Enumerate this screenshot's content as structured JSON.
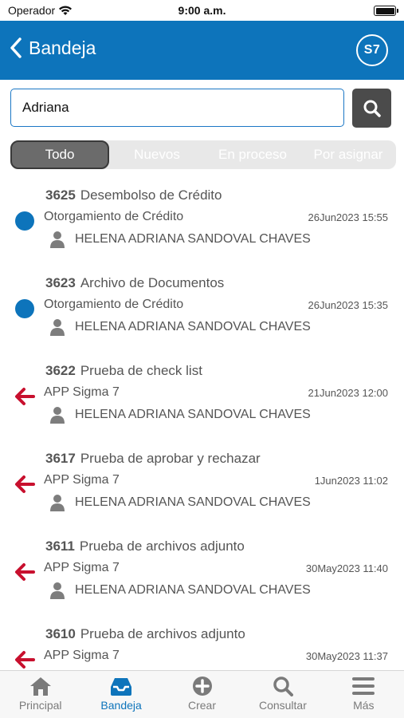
{
  "status_bar": {
    "carrier": "Operador",
    "time": "9:00 a.m."
  },
  "header": {
    "title": "Bandeja",
    "logo_text": "S7"
  },
  "search": {
    "value": "Adriana"
  },
  "filters": [
    "Todo",
    "Nuevos",
    "En proceso",
    "Por asignar"
  ],
  "items": [
    {
      "id": "3625",
      "title": "Desembolso de Crédito",
      "process": "Otorgamiento de Crédito",
      "date": "26Jun2023 15:55",
      "user": "HELENA ADRIANA SANDOVAL CHAVES",
      "status_icon": "dot"
    },
    {
      "id": "3623",
      "title": "Archivo de Documentos",
      "process": "Otorgamiento de Crédito",
      "date": "26Jun2023 15:35",
      "user": "HELENA ADRIANA SANDOVAL CHAVES",
      "status_icon": "dot"
    },
    {
      "id": "3622",
      "title": "Prueba de check list",
      "process": "APP Sigma 7",
      "date": "21Jun2023 12:00",
      "user": "HELENA ADRIANA SANDOVAL CHAVES",
      "status_icon": "arrow"
    },
    {
      "id": "3617",
      "title": "Prueba de aprobar y rechazar",
      "process": "APP Sigma 7",
      "date": "1Jun2023 11:02",
      "user": "HELENA ADRIANA SANDOVAL CHAVES",
      "status_icon": "arrow"
    },
    {
      "id": "3611",
      "title": "Prueba de archivos adjunto",
      "process": "APP Sigma 7",
      "date": "30May2023 11:40",
      "user": "HELENA ADRIANA SANDOVAL CHAVES",
      "status_icon": "arrow"
    },
    {
      "id": "3610",
      "title": "Prueba de archivos adjunto",
      "process": "APP Sigma 7",
      "date": "30May2023 11:37",
      "user": "",
      "status_icon": "arrow"
    }
  ],
  "tabs": [
    {
      "label": "Principal",
      "icon": "home-icon"
    },
    {
      "label": "Bandeja",
      "icon": "inbox-icon"
    },
    {
      "label": "Crear",
      "icon": "plus-circle-icon"
    },
    {
      "label": "Consultar",
      "icon": "search-icon"
    },
    {
      "label": "Más",
      "icon": "menu-icon"
    }
  ],
  "colors": {
    "brand": "#0d74bb",
    "arrow": "#c8102e",
    "active_tab": "#0d74bb"
  }
}
